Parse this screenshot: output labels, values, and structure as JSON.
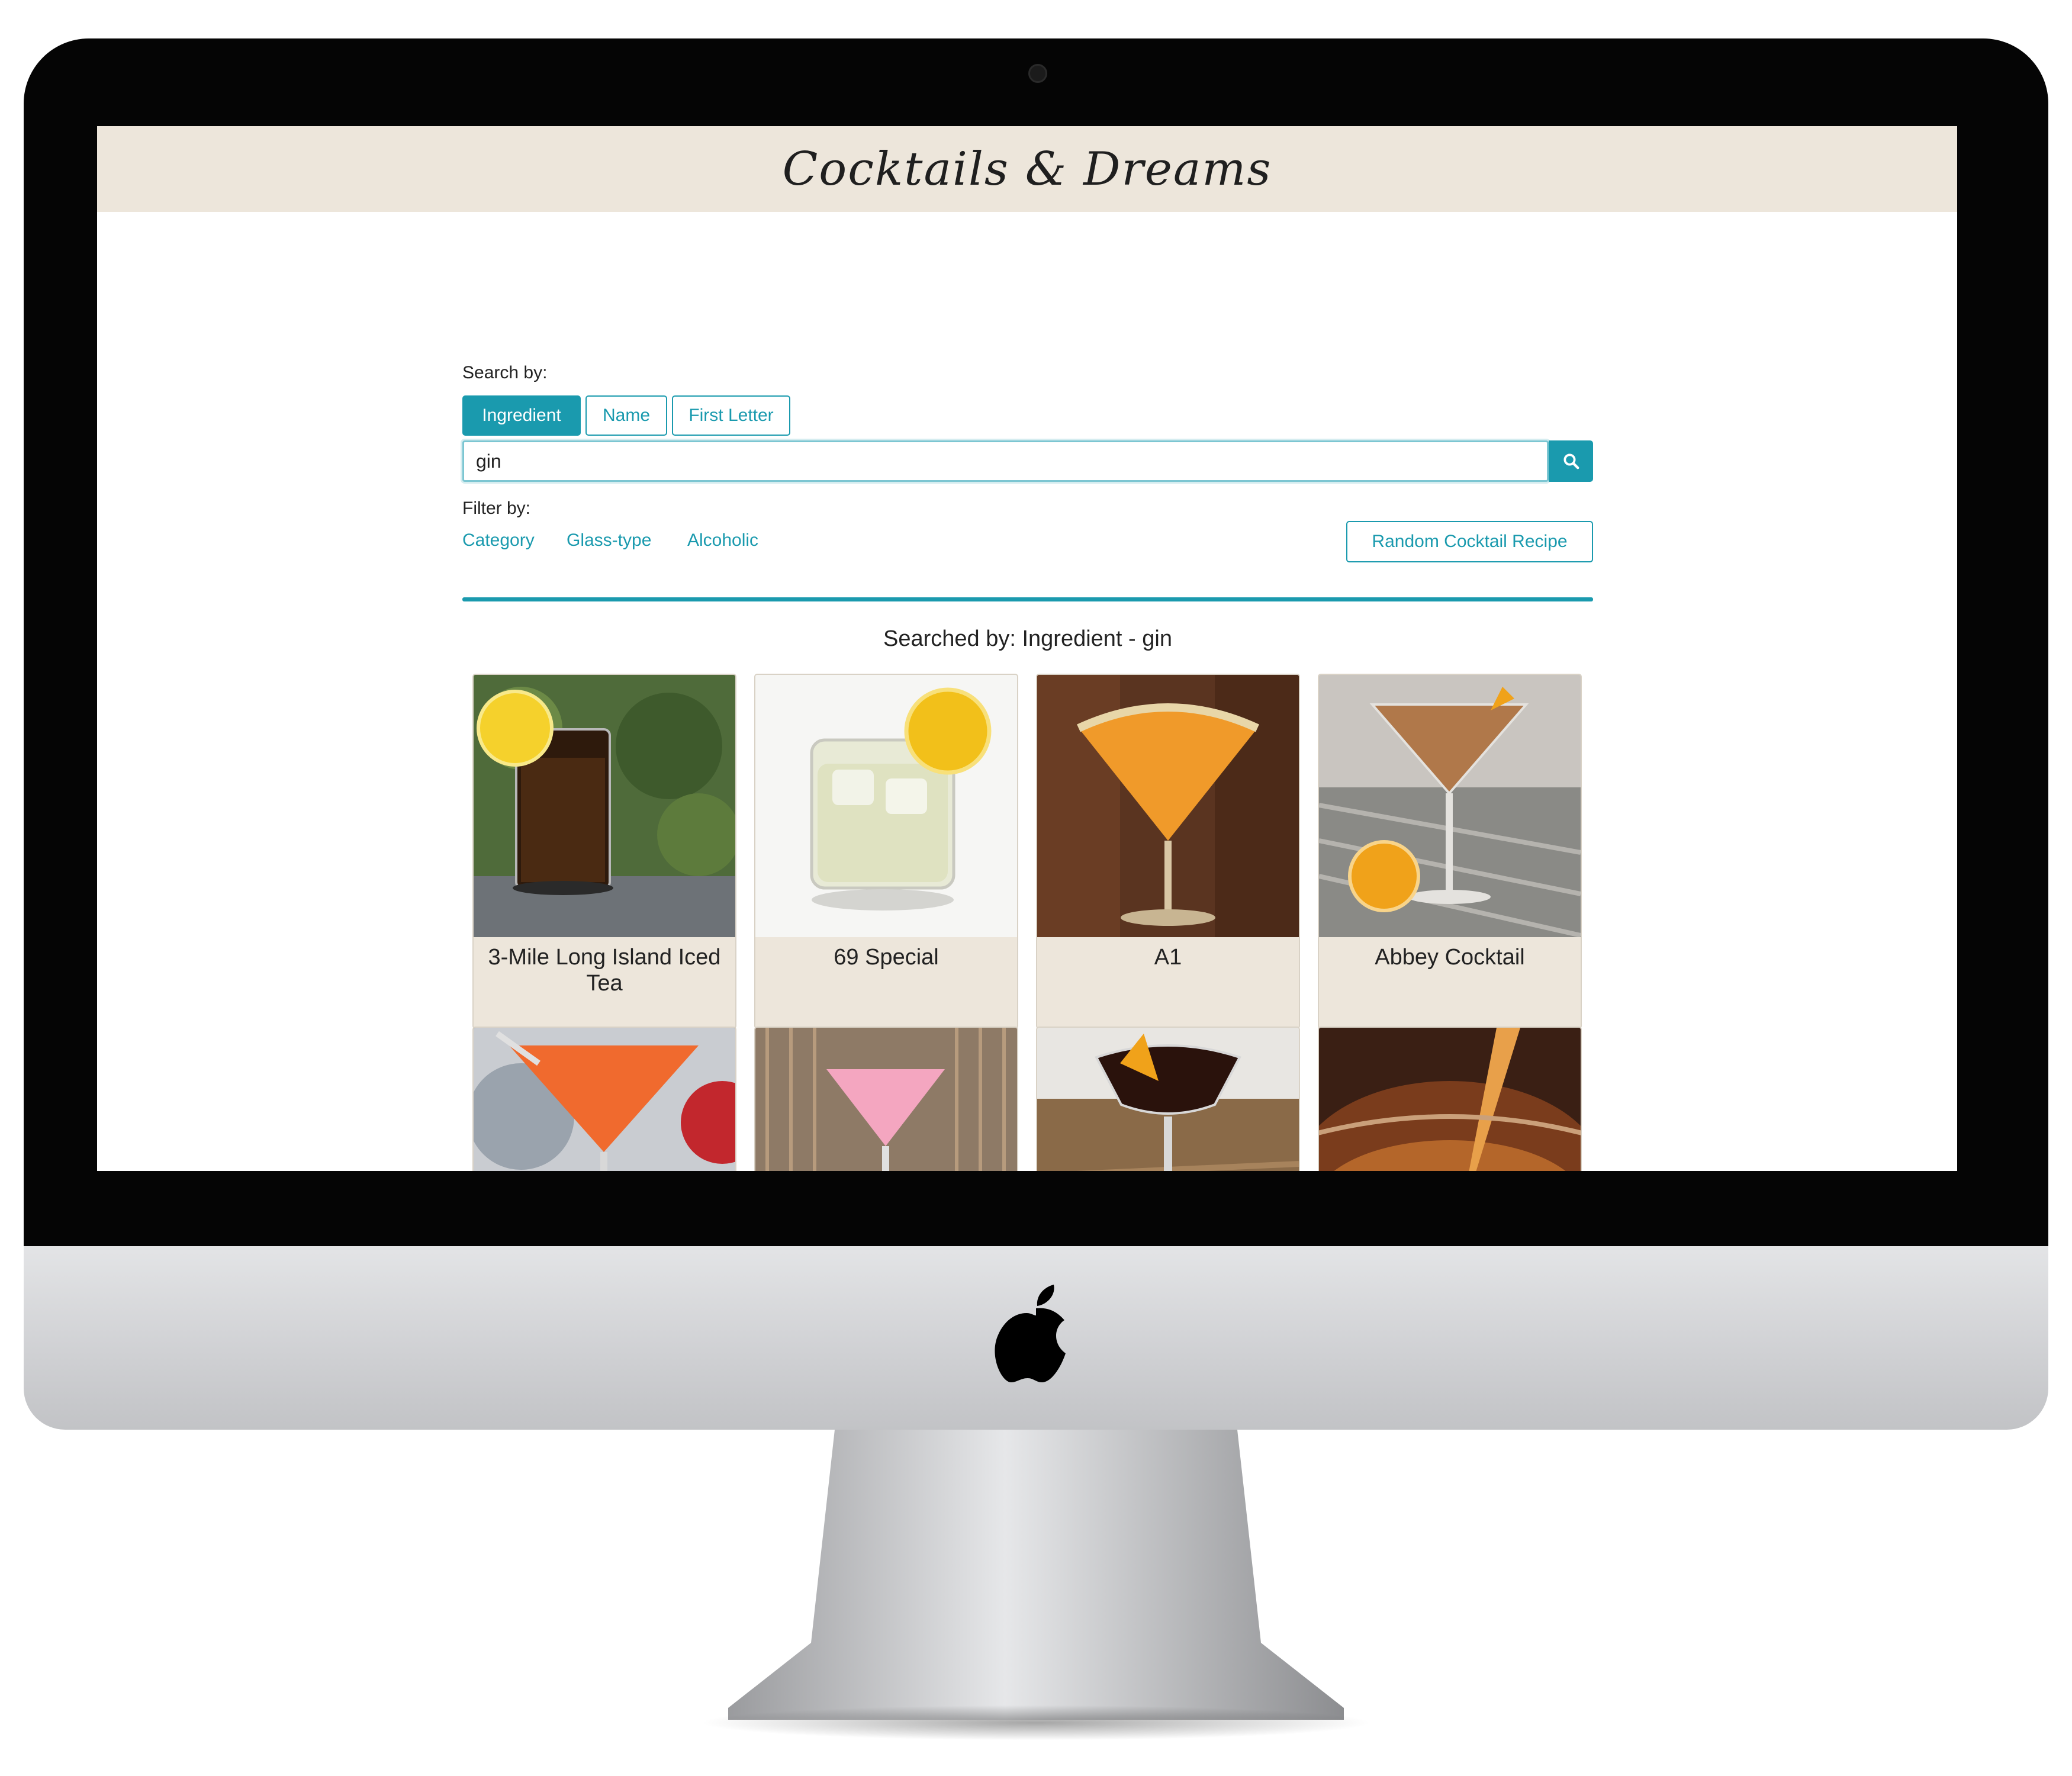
{
  "site": {
    "title": "Cocktails & Dreams"
  },
  "search": {
    "label": "Search by:",
    "tabs": [
      "Ingredient",
      "Name",
      "First Letter"
    ],
    "active_tab": "Ingredient",
    "value": "gin",
    "button_icon": "search-icon"
  },
  "filter": {
    "label": "Filter by:",
    "links": [
      "Category",
      "Glass-type",
      "Alcoholic"
    ],
    "random_button": "Random Cocktail Recipe"
  },
  "results": {
    "heading": "Searched by: Ingredient - gin",
    "cards": [
      {
        "title": "3-Mile Long Island Iced Tea"
      },
      {
        "title": "69 Special"
      },
      {
        "title": "A1"
      },
      {
        "title": "Abbey Cocktail"
      },
      {
        "title": ""
      },
      {
        "title": ""
      },
      {
        "title": ""
      },
      {
        "title": ""
      }
    ]
  },
  "colors": {
    "accent": "#1a9aae",
    "header_bg": "#ede6db",
    "card_bg": "#ede6db"
  }
}
